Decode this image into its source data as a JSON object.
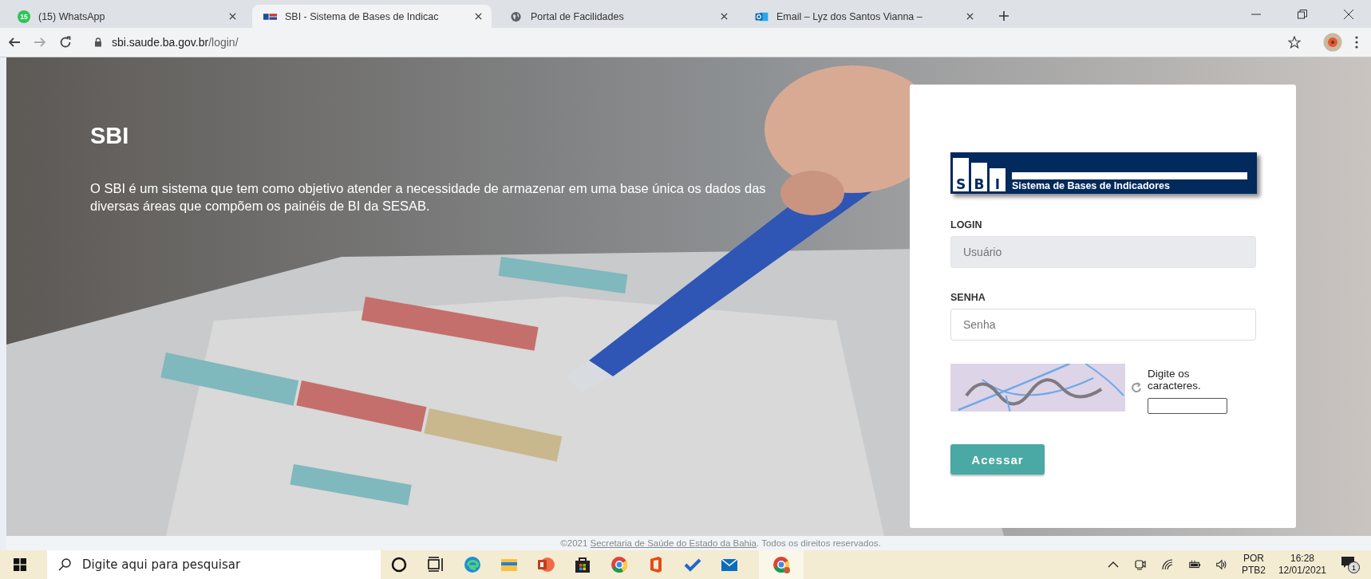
{
  "tabs": [
    {
      "title": "(15) WhatsApp",
      "kind": "whatsapp",
      "badge": "15",
      "selected": false
    },
    {
      "title": "SBI - Sistema de Bases de Indicac",
      "kind": "flag",
      "selected": true
    },
    {
      "title": "Portal de Facilidades",
      "kind": "globe",
      "selected": false
    },
    {
      "title": "Email – Lyz dos Santos Vianna –",
      "kind": "outlook",
      "selected": false
    }
  ],
  "address": {
    "host": "sbi.saude.ba.gov.br",
    "path": "/login/"
  },
  "hero": {
    "title": "SBI",
    "text": "O SBI é um sistema que tem como objetivo atender a necessidade de armazenar em uma base única os dados das diversas áreas que compõem os painéis de BI da SESAB."
  },
  "login": {
    "logo": {
      "letters": [
        "S",
        "B",
        "I"
      ],
      "subtitle": "Sistema de Bases de Indicadores"
    },
    "fields": [
      {
        "label": "LOGIN",
        "placeholder": "Usuário",
        "focused": true
      },
      {
        "label": "SENHA",
        "placeholder": "Senha",
        "focused": false
      }
    ],
    "captcha": {
      "kind": "picture",
      "prompt": "Digite os caracteres."
    },
    "submit": "Acessar"
  },
  "footer": {
    "before": "©2021 ",
    "link": "Secretaria de Saúde do Estado da Bahia",
    "after": ". Todos os direitos reservados."
  },
  "taskbar": {
    "search_placeholder": "Digite aqui para pesquisar",
    "apps": [
      {
        "kind": "cortana",
        "selected": false
      },
      {
        "kind": "taskview",
        "selected": false
      },
      {
        "kind": "edge",
        "selected": false
      },
      {
        "kind": "folder",
        "selected": false
      },
      {
        "kind": "powerpoint",
        "selected": false
      },
      {
        "kind": "store",
        "selected": false
      },
      {
        "kind": "chrome",
        "selected": false
      },
      {
        "kind": "office",
        "selected": false
      },
      {
        "kind": "todo",
        "selected": false
      },
      {
        "kind": "mail",
        "selected": false
      },
      {
        "kind": "chrome",
        "selected": true
      }
    ],
    "language": "POR",
    "layout": "PTB2",
    "time": "16:28",
    "date": "12/01/2021",
    "notifications": "1"
  }
}
